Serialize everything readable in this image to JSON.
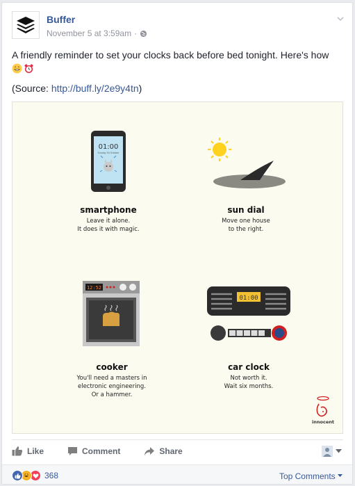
{
  "post": {
    "author": "Buffer",
    "timestamp": "November 5 at 3:59am",
    "separator": "·",
    "text": "A friendly reminder to set your clocks back before bed tonight. Here's how",
    "source_prefix": "(Source: ",
    "source_link": "http://buff.ly/2e9y4tn",
    "source_suffix": ")"
  },
  "infographic": {
    "smartphone": {
      "screen_time": "01:00",
      "screen_sub": "Sunday 30 October",
      "title": "smartphone",
      "line1": "Leave it alone.",
      "line2": "It does it with magic."
    },
    "sundial": {
      "title": "sun dial",
      "line1": "Move one house",
      "line2": "to the right."
    },
    "cooker": {
      "display": "12:52",
      "title": "cooker",
      "line1": "You'll need a masters in",
      "line2": "electronic engineering.",
      "line3": "Or a hammer."
    },
    "carclock": {
      "display": "01:00",
      "title": "car clock",
      "line1": "Not worth it.",
      "line2": "Wait six months."
    },
    "brand": "innocent"
  },
  "actions": {
    "like": "Like",
    "comment": "Comment",
    "share": "Share"
  },
  "footer": {
    "reaction_count": "368",
    "sort_label": "Top Comments"
  },
  "colors": {
    "link": "#365899",
    "muted": "#90949c",
    "like_blue": "#4267b2",
    "love_red": "#f33e58",
    "haha_yellow": "#f7b125"
  }
}
